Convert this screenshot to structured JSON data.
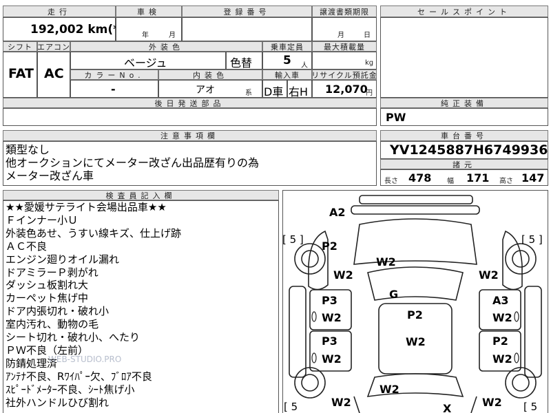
{
  "top": {
    "mileage_header": "走行",
    "mileage": "192,002 km(*)",
    "inspection_header": "車検",
    "inspection_year_unit": "年",
    "inspection_month_unit": "月",
    "registration_header": "登録番号",
    "transfer_header": "譲渡書類期限",
    "transfer_month_unit": "月",
    "transfer_day_unit": "日",
    "shift_header": "シフト",
    "shift": "FAT",
    "aircon_header": "エアコン",
    "aircon": "AC",
    "exterior_header": "外装色",
    "exterior_color": "ベージュ",
    "color_change": "色替",
    "color_no_header": "カラーNo.",
    "color_no": "-",
    "interior_header": "内装色",
    "interior_color": "アオ",
    "interior_suffix": "系",
    "capacity_header": "乗車定員",
    "capacity": "5",
    "capacity_unit": "人",
    "max_load_header": "最大積載量",
    "max_load_unit": "kg",
    "import_header": "輸入車",
    "import_type": "D車",
    "steering": "右H",
    "recycle_header": "リサイクル預託金",
    "recycle_fee": "12,070",
    "recycle_unit": "円",
    "later_parts_header": "後日発送部品"
  },
  "right": {
    "sales_point_header": "セールスポイント",
    "equipment_header": "純正装備",
    "equipment": "PW",
    "chassis_header": "車台番号",
    "chassis_no": "YV1245887H6749936",
    "dims_header": "諸元",
    "length_label": "長さ",
    "length": "478",
    "width_label": "幅",
    "width": "171",
    "height_label": "高さ",
    "height": "147"
  },
  "notes": {
    "header": "注意事項欄",
    "lines": [
      "類型なし",
      "他オークションにてメーター改ざん出品歴有りの為",
      "メーター改ざん車"
    ]
  },
  "inspector": {
    "header": "検査員記入欄",
    "lines": [
      "★★愛媛サテライト会場出品車★★",
      "Ｆインナー小Ｕ",
      "外装色あせ、うすい線キズ、仕上げ跡",
      "ＡＣ不良",
      "エンジン廻りオイル漏れ",
      "ドアミラーＰ剥がれ",
      "ダッシュ板割れ大",
      "カーペット焦げ中",
      "ドア内張切れ・破れ小",
      "室内汚れ、動物の毛",
      "シート切れ・破れ小、へたり",
      "ＰＷ不良（左前）",
      "防錆処理済",
      "ｱﾝﾃﾅ不良、Rﾜｲﾊﾟｰ欠、ﾌﾞﾛｱ不良",
      "ｽﾋﾟｰﾄﾞﾒｰﾀｰ不良、ｼｰﾄ焦げ小",
      "社外ハンドルひび割れ"
    ],
    "watermark": "WEB-STUDIO.PRO"
  },
  "diagram": {
    "tire_left_top": "[ 5 ]",
    "tire_right_top": "[ 5 ]",
    "tire_left_bottom": "[ 5",
    "tire_right_bottom": "[ 5",
    "marks": {
      "a2_top": "A2",
      "p2_left_front": "P2",
      "w2_hood": "W2",
      "w2_left_front": "W2",
      "w2_right_front": "W2",
      "g_glass": "G",
      "p3_left_front_door": "P3",
      "w2_left_front_door": "W2",
      "a3_right_front_door": "A3",
      "w2_right_front_door": "W2",
      "p2_roof": "P2",
      "p3_left_rear_door": "P3",
      "w2_left_rear_door": "W2",
      "p2_right_rear_door": "P2",
      "w2_right_rear_door": "W2",
      "w2_roof_rear": "W2",
      "w2_trunk": "W2",
      "w2_left_rear": "W2",
      "w2_right_rear": "W2",
      "x_bottom": "X"
    }
  }
}
